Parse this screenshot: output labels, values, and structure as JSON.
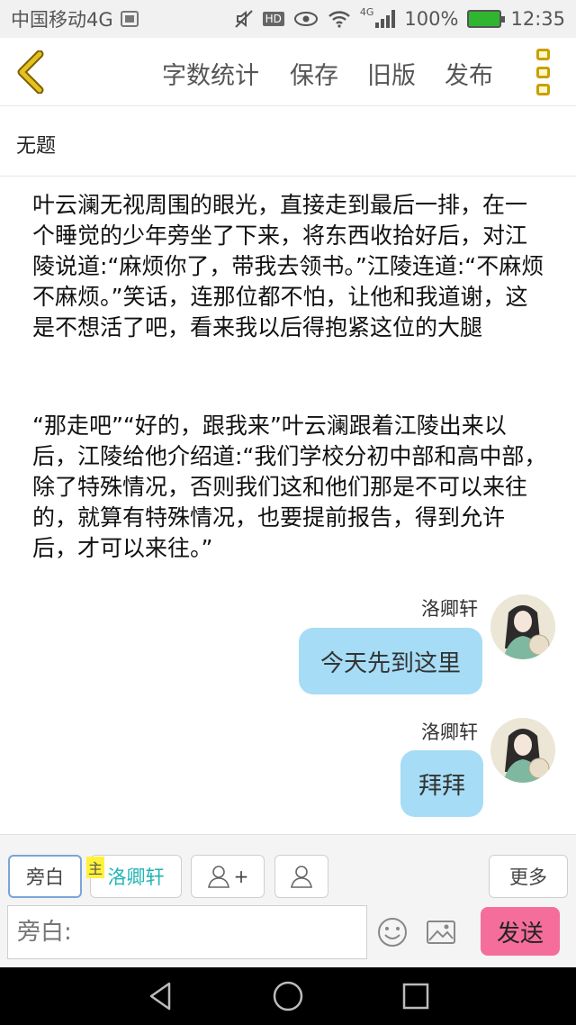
{
  "status_bar": {
    "carrier": "中国移动4G",
    "hd": "HD",
    "network": "4G",
    "battery": "100%",
    "time": "12:35"
  },
  "toolbar": {
    "word_count": "字数统计",
    "save": "保存",
    "old_version": "旧版",
    "publish": "发布"
  },
  "document": {
    "title": "无题",
    "paragraphs": [
      "叶云澜无视周围的眼光，直接走到最后一排，在一个睡觉的少年旁坐了下来，将东西收拾好后，对江陵说道:“麻烦你了，带我去领书。”江陵连道:“不麻烦不麻烦。”笑话，连那位都不怕，让他和我道谢，这是不想活了吧，看来我以后得抱紧这位的大腿",
      "“那走吧”“好的，跟我来”叶云澜跟着江陵出来以后，江陵给他介绍道:“我们学校分初中部和高中部，除了特殊情况，否则我们这和他们那是不可以来往的，就算有特殊情况，也要提前报告，得到允许后，才可以来往。”"
    ],
    "messages": [
      {
        "sender": "洛卿轩",
        "text": "今天先到这里"
      },
      {
        "sender": "洛卿轩",
        "text": "拜拜"
      }
    ]
  },
  "input_bar": {
    "narration_chip": "旁白",
    "master_tag": "主",
    "character_chip": "洛卿轩",
    "add_role_plus": "+",
    "more": "更多",
    "placeholder": "旁白:",
    "send": "发送"
  },
  "colors": {
    "accent_gold": "#c8a000",
    "bubble": "#a6dcf5",
    "send_button": "#f56e9b",
    "character_name": "#22b4b4"
  },
  "icons": [
    "back-chevron-icon",
    "more-dots-icon",
    "add-role-icon",
    "role-icon",
    "emoji-icon",
    "image-icon",
    "nav-back-icon",
    "nav-home-icon",
    "nav-recent-icon"
  ]
}
